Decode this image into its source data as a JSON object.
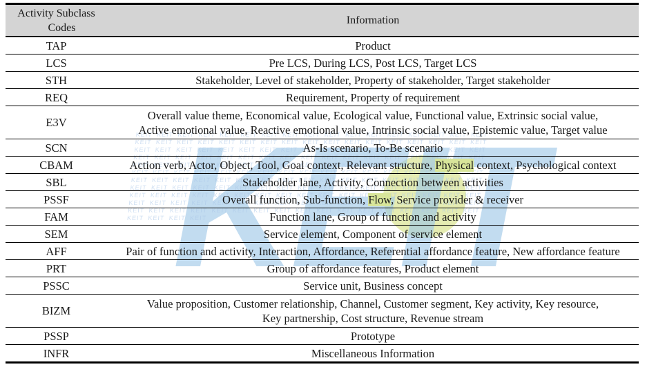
{
  "table": {
    "headers": {
      "code_line1": "Activity Subclass",
      "code_line2": "Codes",
      "information": "Information"
    },
    "rows": [
      {
        "code": "TAP",
        "lines": [
          "Product"
        ]
      },
      {
        "code": "LCS",
        "lines": [
          "Pre LCS, During LCS, Post LCS, Target LCS"
        ]
      },
      {
        "code": "STH",
        "lines": [
          "Stakeholder, Level of stakeholder, Property of stakeholder, Target stakeholder"
        ]
      },
      {
        "code": "REQ",
        "lines": [
          "Requirement, Property of requirement"
        ]
      },
      {
        "code": "E3V",
        "lines": [
          "Overall value theme, Economical value, Ecological value, Functional value, Extrinsic social value,",
          "Active emotional value, Reactive emotional value, Intrinsic social value, Epistemic value, Target value"
        ]
      },
      {
        "code": "SCN",
        "lines": [
          "As-Is scenario, To-Be scenario"
        ]
      },
      {
        "code": "CBAM",
        "lines": [
          "Action verb, Actor, Object, Tool, Goal context, Relevant structure, Physical context, Psychological context"
        ]
      },
      {
        "code": "SBL",
        "lines": [
          "Stakeholder lane, Activity, Connection between activities"
        ]
      },
      {
        "code": "PSSF",
        "lines": [
          "Overall function, Sub-function, Flow, Service provider & receiver"
        ]
      },
      {
        "code": "FAM",
        "lines": [
          "Function lane, Group of function and activity"
        ]
      },
      {
        "code": "SEM",
        "lines": [
          "Service element, Component of service element"
        ]
      },
      {
        "code": "AFF",
        "lines": [
          "Pair of function and activity, Interaction, Affordance, Referential affordance feature, New affordance feature"
        ]
      },
      {
        "code": "PRT",
        "lines": [
          "Group of affordance features, Product element"
        ]
      },
      {
        "code": "PSSC",
        "lines": [
          "Service unit, Business concept"
        ]
      },
      {
        "code": "BIZM",
        "lines": [
          "Value proposition, Customer relationship, Channel, Customer segment,    Key activity, Key resource,",
          "Key partnership, Cost structure, Revenue stream"
        ]
      },
      {
        "code": "PSSP",
        "lines": [
          "Prototype"
        ]
      },
      {
        "code": "INFR",
        "lines": [
          "Miscellaneous Information"
        ]
      }
    ]
  },
  "watermark": {
    "big_text": "KEIT",
    "tile_text": "KEIT KEIT KEIT KEIT KEIT KEIT KEIT KEIT KEIT KEIT KEIT KEIT KEIT KEIT KEIT KEIT KEIT KEIT KEIT KEIT KEIT KEIT KEIT KEIT KEIT KEIT KEIT KEIT KEIT KEIT KEIT KEIT KEIT KEIT KEIT KEIT KEIT KEIT KEIT KEIT KEIT KEIT KEIT KEIT KEIT KEIT KEIT KEIT KEIT KEIT KEIT KEIT KEIT KEIT KEIT KEIT KEIT KEIT KEIT KEIT KEIT KEIT KEIT KEIT KEIT KEIT KEIT KEIT KEIT KEIT KEIT KEIT KEIT KEIT KEIT KEIT KEIT KEIT KEIT KEIT KEIT KEIT KEIT KEIT KEIT KEIT KEIT KEIT KEIT KEIT KEIT KEIT KEIT KEIT KEIT KEIT KEIT KEIT KEIT KEIT KEIT KEIT KEIT KEIT KEIT KEIT KEIT KEIT KEIT KEIT KEIT KEIT KEIT KEIT KEIT KEIT KEIT KEIT KEIT KEIT KEIT KEIT KEIT KEIT KEIT KEIT KEIT KEIT KEIT KEIT KEIT KEIT KEIT KEIT KEIT KEIT KEIT KEIT KEIT KEIT KEIT KEIT KEIT KEIT KEIT KEIT KEIT KEIT KEIT KEIT KEIT KEIT KEIT KEIT KEIT KEIT KEIT KEIT KEIT KEIT KEIT KEIT KEIT KEIT KEIT KEIT KEIT KEIT KEIT KEIT KEIT KEIT KEIT KEIT KEIT KEIT KEIT KEIT KEIT KEIT KEIT KEIT KEIT KEIT KEIT KEIT KEIT KEIT KEIT KEIT KEIT"
  },
  "colors": {
    "header_background": "#d4d4d4",
    "rule": "#000000",
    "watermark_blue": "#9ec7e8",
    "watermark_green": "#cfdc72",
    "highlight": "#d8e59a",
    "text": "#1a1a1a"
  }
}
